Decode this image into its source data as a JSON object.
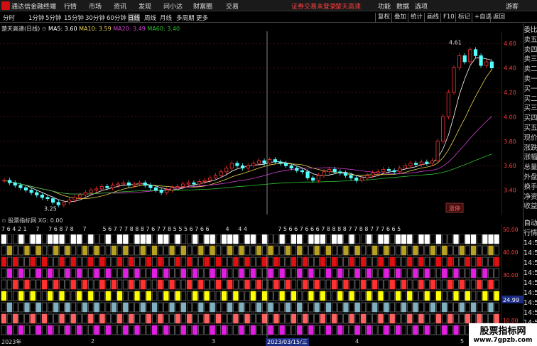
{
  "app": {
    "title": "通达信金融终端",
    "menus": [
      "行情",
      "市场",
      "资讯",
      "发现",
      "问小达",
      "财富圈",
      "交易"
    ],
    "right_menus": [
      "功能",
      "数据",
      "选项",
      "游客"
    ],
    "notice": "证券交易未登录",
    "stock_name_top": "楚天高速"
  },
  "toolbar": {
    "periods": [
      "分时",
      "1分钟",
      "5分钟",
      "15分钟",
      "30分钟",
      "60分钟",
      "日线",
      "周线",
      "月线",
      "多周期",
      "更多"
    ],
    "active": "日线",
    "right": [
      "复权",
      "叠加",
      "统计",
      "画线",
      "F10",
      "标记",
      "+自选",
      "返回"
    ]
  },
  "chart": {
    "title": "楚天高速(日线)",
    "ma": [
      {
        "label": "MA5: 3.60",
        "color": "#ffffff"
      },
      {
        "label": "MA10: 3.59",
        "color": "#e8d44d"
      },
      {
        "label": "MA20: 3.49",
        "color": "#d040d0"
      },
      {
        "label": "MA60: 3.40",
        "color": "#30c030"
      }
    ],
    "y_ticks": [
      "4.60",
      "4.40",
      "4.20",
      "4.00",
      "3.80",
      "3.60",
      "3.40"
    ],
    "high_label": "4.61",
    "low_label": "3.25",
    "tag": "涨停",
    "ylim": [
      3.2,
      4.7
    ],
    "candles": [
      3.48,
      3.46,
      3.44,
      3.42,
      3.4,
      3.38,
      3.36,
      3.34,
      3.33,
      3.3,
      3.28,
      3.3,
      3.32,
      3.34,
      3.36,
      3.38,
      3.4,
      3.41,
      3.43,
      3.42,
      3.44,
      3.45,
      3.46,
      3.44,
      3.45,
      3.46,
      3.44,
      3.42,
      3.4,
      3.38,
      3.4,
      3.42,
      3.43,
      3.45,
      3.46,
      3.45,
      3.47,
      3.48,
      3.5,
      3.52,
      3.55,
      3.58,
      3.62,
      3.6,
      3.58,
      3.6,
      3.62,
      3.64,
      3.62,
      3.65,
      3.63,
      3.62,
      3.6,
      3.58,
      3.56,
      3.55,
      3.5,
      3.48,
      3.52,
      3.55,
      3.57,
      3.55,
      3.54,
      3.52,
      3.5,
      3.48,
      3.5,
      3.52,
      3.54,
      3.55,
      3.57,
      3.56,
      3.55,
      3.58,
      3.6,
      3.62,
      3.61,
      3.63,
      3.62,
      3.64,
      3.8,
      4.0,
      4.2,
      4.4,
      4.5,
      4.45,
      4.55,
      4.5,
      4.42,
      4.45,
      4.4
    ]
  },
  "indicator": {
    "title": "股票指标网 XG: 0.00",
    "scale": [
      "50.00",
      "40.00",
      "30.00",
      "20.00",
      "10.00"
    ],
    "value": "24.99",
    "row_colors": [
      "#ffffff",
      "#b8a020",
      "#e01010",
      "#e020e0",
      "#ff3030",
      "#ffff00",
      "#80b0c0",
      "#ff6060",
      "#e020e0"
    ],
    "top_digits": "7 6 4 2 1     7     7 6 8 7 8     7         5 6 7 7 7 8 8 8 7 6 7 7 8 5 5 5 6 7 6 6         4     4 4                 7 5 6 6 7 6 6 6 7 8 8 8 8 7 7 8 8 7 7 7 6 6 5"
  },
  "right_panel": {
    "items": [
      "委比",
      "卖五",
      "卖四",
      "卖三",
      "卖二",
      "卖一",
      "买一",
      "买二",
      "买三",
      "买四",
      "买五",
      "现价",
      "涨跌",
      "涨幅",
      "总量",
      "外盘",
      "换手",
      "净资",
      "收益"
    ],
    "lower": [
      "自动",
      "行情",
      "14:5",
      "14:5",
      "14:5",
      "14:5",
      "14:5",
      "14:5",
      "14:5",
      "14:5",
      "14:5"
    ]
  },
  "x_axis": {
    "labels": [
      "2023年",
      "2",
      "3",
      "2023/03/15/三",
      "4",
      "5"
    ]
  },
  "watermark": {
    "line1": "股票指标网",
    "line2": "www.7gpzb.com"
  }
}
